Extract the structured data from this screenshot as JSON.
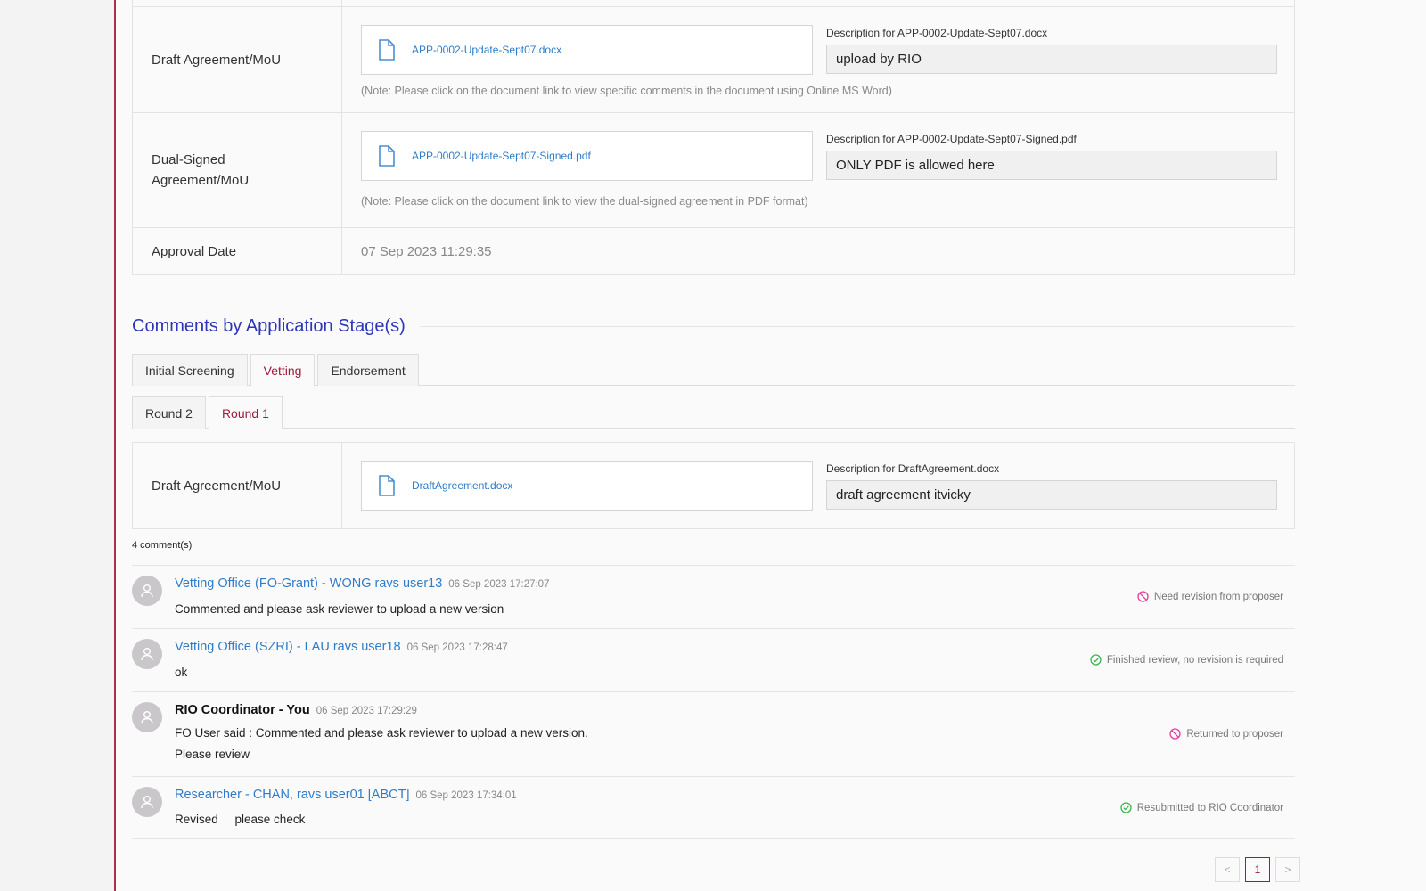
{
  "documents": [
    {
      "label": "Draft Agreement/MoU",
      "file_name": "APP-0002-Update-Sept07.docx",
      "description_label": "Description for APP-0002-Update-Sept07.docx",
      "description_value": "upload by RIO",
      "note": "(Note: Please click on the document link to view specific comments in the document using Online MS Word)"
    },
    {
      "label": "Dual-Signed Agreement/MoU",
      "file_name": "APP-0002-Update-Sept07-Signed.pdf",
      "description_label": "Description for APP-0002-Update-Sept07-Signed.pdf",
      "description_value": "ONLY PDF is allowed here",
      "note": "(Note: Please click on the document link to view the dual-signed agreement in PDF format)"
    }
  ],
  "approval": {
    "label": "Approval Date",
    "value": "07 Sep 2023 11:29:35"
  },
  "section_title": "Comments by Application Stage(s)",
  "stage_tabs": [
    {
      "label": "Initial Screening",
      "active": false
    },
    {
      "label": "Vetting",
      "active": true
    },
    {
      "label": "Endorsement",
      "active": false
    }
  ],
  "round_tabs": [
    {
      "label": "Round 2",
      "active": false
    },
    {
      "label": "Round 1",
      "active": true
    }
  ],
  "round_doc": {
    "label": "Draft Agreement/MoU",
    "file_name": "DraftAgreement.docx",
    "description_label": "Description for DraftAgreement.docx",
    "description_value": "draft agreement itvicky"
  },
  "comment_count": "4 comment(s)",
  "comments": [
    {
      "author": "Vetting Office (FO-Grant) - WONG ravs user13",
      "time": "06 Sep 2023 17:27:07",
      "text": "Commented and please ask reviewer to upload a new version",
      "status": "Need revision from proposer",
      "status_type": "blocked"
    },
    {
      "author": "Vetting Office (SZRI) - LAU ravs user18",
      "time": "06 Sep 2023 17:28:47",
      "text": "ok",
      "status": "Finished review, no revision is required",
      "status_type": "ok"
    },
    {
      "author": "RIO Coordinator - You",
      "time": "06 Sep 2023 17:29:29",
      "text": "FO User said : Commented and please ask reviewer to upload a new version.\nPlease review",
      "status": "Returned to proposer",
      "status_type": "blocked"
    },
    {
      "author": "Researcher - CHAN, ravs user01 [ABCT]",
      "time": "06 Sep 2023 17:34:01",
      "text": "Revised     please check",
      "status": "Resubmitted to RIO Coordinator",
      "status_type": "ok"
    }
  ],
  "pagination": {
    "prev": "<",
    "current": "1",
    "next": ">"
  },
  "colors": {
    "accent": "#9b1d3a",
    "link": "#2f7cc9",
    "title": "#2b35b8",
    "ok": "#3bb54a",
    "blocked": "#e0409a"
  }
}
